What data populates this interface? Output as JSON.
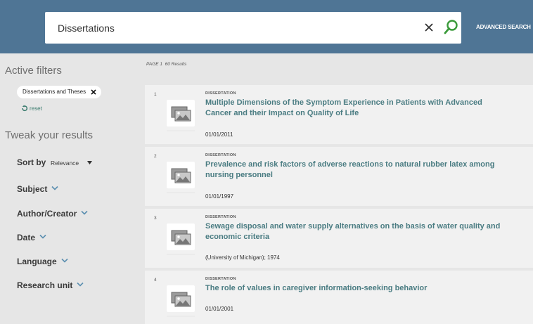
{
  "search": {
    "value": "Dissertations",
    "advanced_label": "ADVANCED SEARCH"
  },
  "sidebar": {
    "active_filters_title": "Active filters",
    "active_filter_chip": "Dissertations and Theses",
    "reset_label": "reset",
    "tweak_title": "Tweak your results",
    "sort_label": "Sort by",
    "sort_value": "Relevance",
    "facets": [
      "Subject",
      "Author/Creator",
      "Date",
      "Language",
      "Research unit"
    ]
  },
  "results_header": {
    "page": "PAGE 1",
    "count": "60 Results"
  },
  "results": [
    {
      "num": "1",
      "type": "DISSERTATION",
      "title": "Multiple Dimensions of the Symptom Experience in Patients with Advanced Cancer and their Impact on Quality of Life",
      "meta": "01/01/2011"
    },
    {
      "num": "2",
      "type": "DISSERTATION",
      "title": "Prevalence and risk factors of adverse reactions to natural rubber latex among nursing personnel",
      "meta": "01/01/1997"
    },
    {
      "num": "3",
      "type": "DISSERTATION",
      "title": "Sewage disposal and water supply alternatives on the basis of water quality and economic criteria",
      "meta": "(University of Michigan); 1974"
    },
    {
      "num": "4",
      "type": "DISSERTATION",
      "title": "The role of values in caregiver information-seeking behavior",
      "meta": "01/01/2001"
    }
  ],
  "colors": {
    "header": "#4f7595",
    "link": "#4a7c82",
    "accent": "#3a9a3a",
    "facet_chevron": "#5b8fb0"
  }
}
